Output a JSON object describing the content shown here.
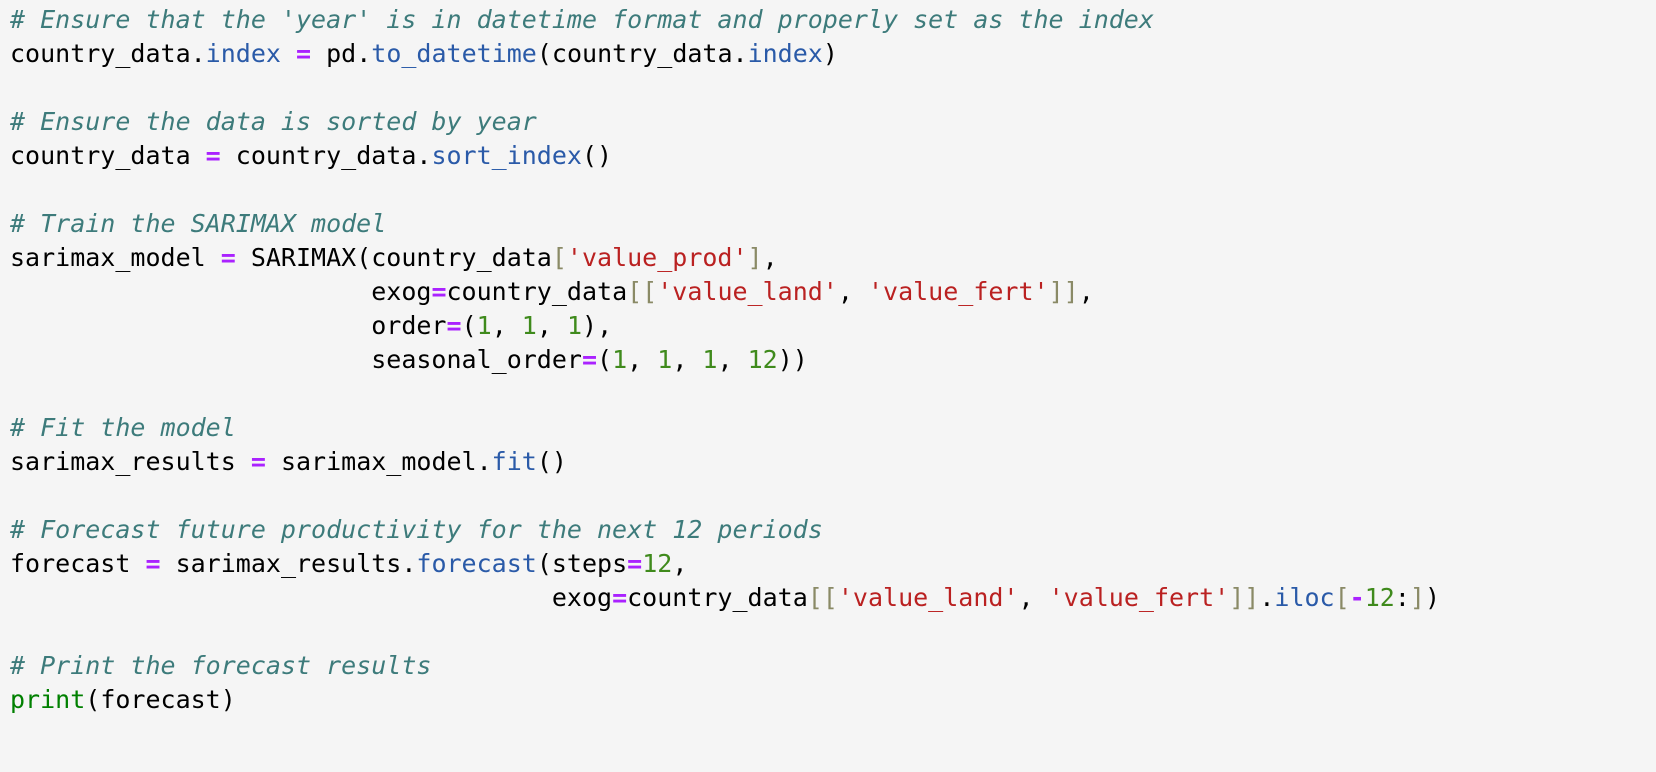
{
  "colors": {
    "background": "#f5f5f5",
    "text": "#000000",
    "comment": "#3d7b7b",
    "attribute": "#2a5aa8",
    "operator": "#aa22ff",
    "string": "#ba2121",
    "number": "#3f8a1c",
    "bracket": "#8a8a66",
    "builtin": "#008000"
  },
  "lines": [
    [
      {
        "t": "comment",
        "v": "# Ensure that the 'year' is in datetime format and properly set as the index"
      }
    ],
    [
      {
        "t": "plain",
        "v": "country_data."
      },
      {
        "t": "attr",
        "v": "index"
      },
      {
        "t": "plain",
        "v": " "
      },
      {
        "t": "op",
        "v": "="
      },
      {
        "t": "plain",
        "v": " pd."
      },
      {
        "t": "attr",
        "v": "to_datetime"
      },
      {
        "t": "plain",
        "v": "(country_data."
      },
      {
        "t": "attr",
        "v": "index"
      },
      {
        "t": "plain",
        "v": ")"
      }
    ],
    [],
    [
      {
        "t": "comment",
        "v": "# Ensure the data is sorted by year"
      }
    ],
    [
      {
        "t": "plain",
        "v": "country_data "
      },
      {
        "t": "op",
        "v": "="
      },
      {
        "t": "plain",
        "v": " country_data."
      },
      {
        "t": "attr",
        "v": "sort_index"
      },
      {
        "t": "plain",
        "v": "()"
      }
    ],
    [],
    [
      {
        "t": "comment",
        "v": "# Train the SARIMAX model"
      }
    ],
    [
      {
        "t": "plain",
        "v": "sarimax_model "
      },
      {
        "t": "op",
        "v": "="
      },
      {
        "t": "plain",
        "v": " SARIMAX(country_data"
      },
      {
        "t": "brk",
        "v": "["
      },
      {
        "t": "str",
        "v": "'value_prod'"
      },
      {
        "t": "brk",
        "v": "]"
      },
      {
        "t": "plain",
        "v": ","
      }
    ],
    [
      {
        "t": "plain",
        "v": "                        exog"
      },
      {
        "t": "op",
        "v": "="
      },
      {
        "t": "plain",
        "v": "country_data"
      },
      {
        "t": "brk",
        "v": "[["
      },
      {
        "t": "str",
        "v": "'value_land'"
      },
      {
        "t": "plain",
        "v": ", "
      },
      {
        "t": "str",
        "v": "'value_fert'"
      },
      {
        "t": "brk",
        "v": "]]"
      },
      {
        "t": "plain",
        "v": ","
      }
    ],
    [
      {
        "t": "plain",
        "v": "                        order"
      },
      {
        "t": "op",
        "v": "="
      },
      {
        "t": "plain",
        "v": "("
      },
      {
        "t": "num",
        "v": "1"
      },
      {
        "t": "plain",
        "v": ", "
      },
      {
        "t": "num",
        "v": "1"
      },
      {
        "t": "plain",
        "v": ", "
      },
      {
        "t": "num",
        "v": "1"
      },
      {
        "t": "plain",
        "v": "),"
      }
    ],
    [
      {
        "t": "plain",
        "v": "                        seasonal_order"
      },
      {
        "t": "op",
        "v": "="
      },
      {
        "t": "plain",
        "v": "("
      },
      {
        "t": "num",
        "v": "1"
      },
      {
        "t": "plain",
        "v": ", "
      },
      {
        "t": "num",
        "v": "1"
      },
      {
        "t": "plain",
        "v": ", "
      },
      {
        "t": "num",
        "v": "1"
      },
      {
        "t": "plain",
        "v": ", "
      },
      {
        "t": "num",
        "v": "12"
      },
      {
        "t": "plain",
        "v": "))"
      }
    ],
    [],
    [
      {
        "t": "comment",
        "v": "# Fit the model"
      }
    ],
    [
      {
        "t": "plain",
        "v": "sarimax_results "
      },
      {
        "t": "op",
        "v": "="
      },
      {
        "t": "plain",
        "v": " sarimax_model."
      },
      {
        "t": "attr",
        "v": "fit"
      },
      {
        "t": "plain",
        "v": "()"
      }
    ],
    [],
    [
      {
        "t": "comment",
        "v": "# Forecast future productivity for the next 12 periods"
      }
    ],
    [
      {
        "t": "plain",
        "v": "forecast "
      },
      {
        "t": "op",
        "v": "="
      },
      {
        "t": "plain",
        "v": " sarimax_results."
      },
      {
        "t": "attr",
        "v": "forecast"
      },
      {
        "t": "plain",
        "v": "(steps"
      },
      {
        "t": "op",
        "v": "="
      },
      {
        "t": "num",
        "v": "12"
      },
      {
        "t": "plain",
        "v": ","
      }
    ],
    [
      {
        "t": "plain",
        "v": "                                    exog"
      },
      {
        "t": "op",
        "v": "="
      },
      {
        "t": "plain",
        "v": "country_data"
      },
      {
        "t": "brk",
        "v": "[["
      },
      {
        "t": "str",
        "v": "'value_land'"
      },
      {
        "t": "plain",
        "v": ", "
      },
      {
        "t": "str",
        "v": "'value_fert'"
      },
      {
        "t": "brk",
        "v": "]]"
      },
      {
        "t": "plain",
        "v": "."
      },
      {
        "t": "attr",
        "v": "iloc"
      },
      {
        "t": "brk",
        "v": "["
      },
      {
        "t": "op",
        "v": "-"
      },
      {
        "t": "num",
        "v": "12"
      },
      {
        "t": "plain",
        "v": ":"
      },
      {
        "t": "brk",
        "v": "]"
      },
      {
        "t": "plain",
        "v": ")"
      }
    ],
    [],
    [
      {
        "t": "comment",
        "v": "# Print the forecast results"
      }
    ],
    [
      {
        "t": "builtin",
        "v": "print"
      },
      {
        "t": "plain",
        "v": "(forecast)"
      }
    ]
  ]
}
